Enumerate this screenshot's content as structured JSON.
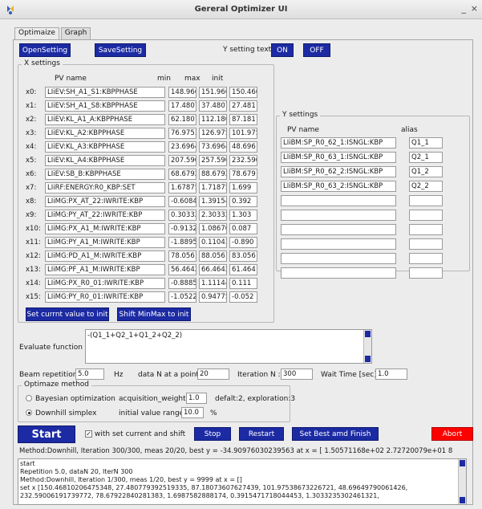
{
  "window": {
    "title": "Gereral Optimizer UI",
    "minimize_glyph": "_",
    "close_glyph": "×"
  },
  "tabs": [
    {
      "label": "Optimaize"
    },
    {
      "label": "Graph"
    }
  ],
  "toolbar": {
    "open_setting": "OpenSetting",
    "save_setting": "SaveSetting",
    "y_setting_text_label": "Y setting text",
    "on": "ON",
    "off": "OFF"
  },
  "x_settings": {
    "title": "X settings",
    "headers": {
      "pv_name": "PV name",
      "min": "min",
      "max": "max",
      "init": "init"
    },
    "rows": [
      {
        "label": "x0:",
        "pv": "LIiEV:SH_A1_S1:KBPPHASE",
        "min": "148.966",
        "max": "151.966",
        "init": "150.466"
      },
      {
        "label": "x1:",
        "pv": "LIiEV:SH_A1_S8:KBPPHASE",
        "min": "17.4807",
        "max": "37.4807",
        "init": "27.481"
      },
      {
        "label": "x2:",
        "pv": "LIiEV:KL_A1_A:KBPPHASE",
        "min": "62.1807",
        "max": "112.180",
        "init": "87.181"
      },
      {
        "label": "x3:",
        "pv": "LIiEV:KL_A2:KBPPHASE",
        "min": "76.9753",
        "max": "126.975",
        "init": "101.975"
      },
      {
        "label": "x4:",
        "pv": "LIiEV:KL_A3:KBPPHASE",
        "min": "23.6964",
        "max": "73.6964",
        "init": "48.696"
      },
      {
        "label": "x5:",
        "pv": "LIiEV:KL_A4:KBPPHASE",
        "min": "207.590",
        "max": "257.590",
        "init": "232.590"
      },
      {
        "label": "x6:",
        "pv": "LIiEV:SB_B:KBPPHASE",
        "min": "68.6792",
        "max": "88.6792",
        "init": "78.679"
      },
      {
        "label": "x7:",
        "pv": "LIiRF:ENERGY:R0_KBP:SET",
        "min": "1.67875",
        "max": "1.71875",
        "init": "1.699"
      },
      {
        "label": "x8:",
        "pv": "LIiMG:PX_AT_22:IWRITE:KBP",
        "min": "-0.6084",
        "max": "1.39154",
        "init": "0.392"
      },
      {
        "label": "x9:",
        "pv": "LIiMG:PY_AT_22:IWRITE:KBP",
        "min": "0.30332",
        "max": "2.30332",
        "init": "1.303"
      },
      {
        "label": "x10:",
        "pv": "LIiMG:PX_A1_M:IWRITE:KBP",
        "min": "-0.9132",
        "max": "1.08670",
        "init": "0.087"
      },
      {
        "label": "x11:",
        "pv": "LIiMG:PY_A1_M:IWRITE:KBP",
        "min": "-1.8895",
        "max": "0.11043",
        "init": "-0.890"
      },
      {
        "label": "x12:",
        "pv": "LIiMG:PD_A1_M:IWRITE:KBP",
        "min": "78.0561",
        "max": "88.0561",
        "init": "83.056"
      },
      {
        "label": "x13:",
        "pv": "LIiMG:PF_A1_M:IWRITE:KBP",
        "min": "56.4642",
        "max": "66.4642",
        "init": "61.464"
      },
      {
        "label": "x14:",
        "pv": "LIiMG:PX_R0_01:IWRITE:KBP",
        "min": "-0.8885",
        "max": "1.11144",
        "init": "0.111"
      },
      {
        "label": "x15:",
        "pv": "LIiMG:PY_R0_01:IWRITE:KBP",
        "min": "-1.0522",
        "max": "0.94775",
        "init": "-0.052"
      }
    ],
    "set_current_button": "Set currnt value to init",
    "shift_minmax_button": "Shift MinMax to init"
  },
  "y_settings": {
    "title": "Y settings",
    "headers": {
      "pv_name": "PV name",
      "alias": "alias"
    },
    "rows": [
      {
        "pv": "LIiBM:SP_R0_62_1:ISNGL:KBP",
        "alias": "Q1_1"
      },
      {
        "pv": "LIiBM:SP_R0_63_1:ISNGL:KBP",
        "alias": "Q2_1"
      },
      {
        "pv": "LIiBM:SP_R0_62_2:ISNGL:KBP",
        "alias": "Q1_2"
      },
      {
        "pv": "LIiBM:SP_R0_63_2:ISNGL:KBP",
        "alias": "Q2_2"
      },
      {
        "pv": "",
        "alias": ""
      },
      {
        "pv": "",
        "alias": ""
      },
      {
        "pv": "",
        "alias": ""
      },
      {
        "pv": "",
        "alias": ""
      },
      {
        "pv": "",
        "alias": ""
      },
      {
        "pv": "",
        "alias": ""
      }
    ]
  },
  "evaluate": {
    "label": "Evaluate function :",
    "value": "-(Q1_1+Q2_1+Q1_2+Q2_2)"
  },
  "params": {
    "beam_rep_label": "Beam repetition:",
    "beam_rep_value": "5.0",
    "hz": "Hz",
    "data_n_label": "data N at a point:",
    "data_n_value": "20",
    "iteration_label": "Iteration N :",
    "iteration_value": "300",
    "wait_label": "Wait Time [sec]:",
    "wait_value": "1.0"
  },
  "method": {
    "title": "Optimaze method",
    "bayesian_label": "Bayesian optimization",
    "acq_label": "acquisition_weight:",
    "acq_value": "1.0",
    "acq_hint": "defalt:2, exploration:3",
    "downhill_label": "Downhill simplex",
    "init_range_label": "initial value range:",
    "init_range_value": "10.0",
    "percent": "%"
  },
  "controls": {
    "start": "Start",
    "with_shift_label": "with set current and shift",
    "stop": "Stop",
    "restart": "Restart",
    "set_best": "Set Best amd Finish",
    "abort": "Abort",
    "abort_color": "#ff0000",
    "accent_color": "#1c2ba3"
  },
  "status": {
    "line": "Method:Downhill, Iteration 300/300, meas 20/20, best y = -34.90976030239563 at x = [ 1.50571168e+02  2.72720079e+01  8"
  },
  "log": {
    "lines": [
      "start",
      "Repetition 5.0, dataN 20, IterN 300",
      "Method:Downhill, Iteration 1/300, meas 1/20, best y = 9999 at x = []",
      "set x [150.46810206475348, 27.480779392519335, 87.18073607627439, 101.97538673226721, 48.69649790061426,",
      "232.59006191739772, 78.67922840281383, 1.6987582888174, 0.3915471718044453, 1.3033235302461321,"
    ]
  }
}
